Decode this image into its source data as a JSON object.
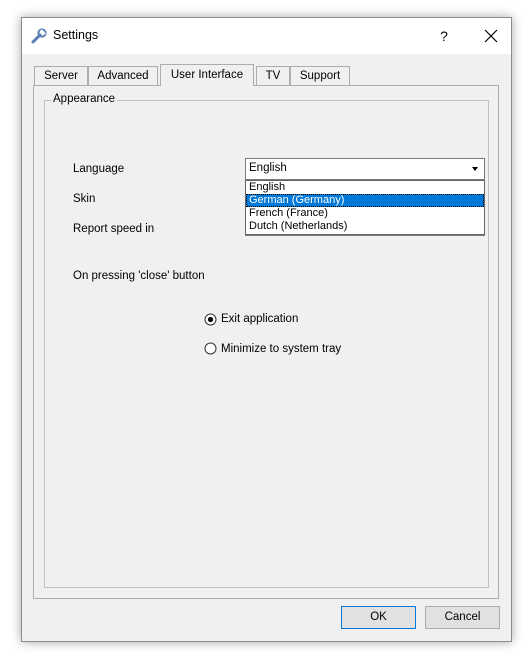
{
  "window": {
    "title": "Settings",
    "help_label": "?"
  },
  "tabs": [
    {
      "label": "Server",
      "active": false
    },
    {
      "label": "Advanced",
      "active": false
    },
    {
      "label": "User Interface",
      "active": true
    },
    {
      "label": "TV",
      "active": false
    },
    {
      "label": "Support",
      "active": false
    }
  ],
  "appearance": {
    "group_title": "Appearance",
    "language_label": "Language",
    "skin_label": "Skin",
    "report_speed_label": "Report speed in",
    "language": {
      "value": "English",
      "options": [
        "English",
        "German (Germany)",
        "French (France)",
        "Dutch (Netherlands)"
      ],
      "highlighted": "German (Germany)"
    },
    "close_behavior_label": "On pressing 'close' button",
    "close_options": [
      {
        "label": "Exit application",
        "checked": true
      },
      {
        "label": "Minimize to system tray",
        "checked": false
      }
    ]
  },
  "buttons": {
    "ok": "OK",
    "cancel": "Cancel"
  },
  "colors": {
    "selection": "#0078d7",
    "dialog_bg": "#f0f0f0"
  },
  "icons": {
    "title": "wrench-icon",
    "close": "close-icon",
    "combo_arrow": "chevron-down-icon"
  }
}
